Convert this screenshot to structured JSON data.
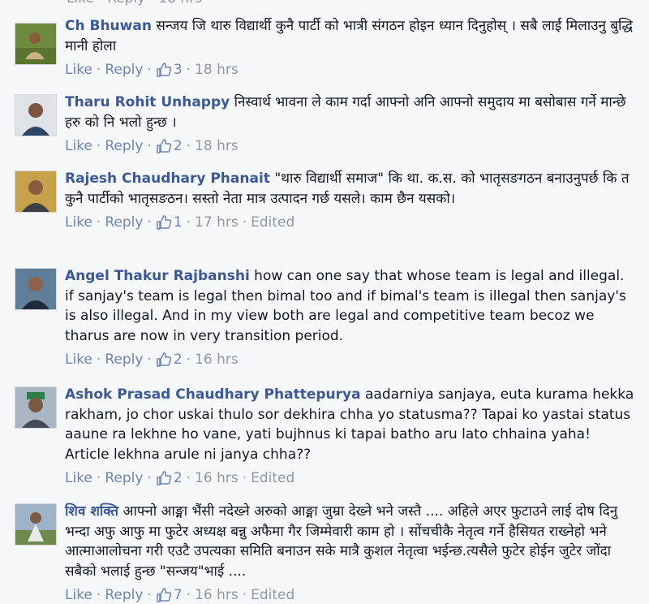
{
  "top_cut_text": "Like · Reply · 18 hrs",
  "labels": {
    "like": "Like",
    "reply": "Reply",
    "dot": "·"
  },
  "colors": {
    "author": "#3b5998",
    "link": "#6d84b4",
    "meta": "#9197a3",
    "text": "#141823",
    "background": "#f6f7f9"
  },
  "comments": [
    {
      "author": "Ch Bhuwan",
      "text": "सन्जय जि थारु विद्यार्थी कुनै पार्टी को भात्री संगठन होइन ध्यान दिनुहोस् । सबै लाई मिलाउनु बुद्धि मानी होला",
      "likes": "3",
      "time": "18 hrs",
      "edited": "",
      "avatar_icon": "person-outdoor-avatar-icon"
    },
    {
      "author": "Tharu Rohit Unhappy",
      "text": "निस्वार्थ भावना ले काम गर्दा आफ्नो अनि आफ्नो समुदाय मा बसोबास गर्ने मान्छे हरु को नि भलो हुन्छ ।",
      "likes": "2",
      "time": "18 hrs",
      "edited": "",
      "avatar_icon": "person-portrait-avatar-icon"
    },
    {
      "author": "Rajesh Chaudhary Phanait",
      "text": "\"थारु विद्यार्थी समाज\" कि था. क.स. को भातृसङगठन बनाउनुपर्छ कि त कुनै पार्टीको भातृसङठन। सस्तो नेता मात्र उत्पादन गर्छ यसले। काम छैन यसको।",
      "likes": "1",
      "time": "17 hrs",
      "edited": "Edited",
      "avatar_icon": "person-portrait-avatar-icon"
    },
    {
      "author": "Angel Thakur Rajbanshi",
      "text": "how can one say that whose team is legal and illegal. if sanjay's team is legal then bimal too and if bimal's team is illegal then sanjay's is also illegal. And in my view both are legal and competitive team becoz we tharus are now in very transition period.",
      "likes": "2",
      "time": "16 hrs",
      "edited": "",
      "avatar_icon": "person-portrait-avatar-icon"
    },
    {
      "author": "Ashok Prasad Chaudhary Phattepurya",
      "text": "aadarniya sanjaya, euta kurama hekka rakham, jo chor uskai thulo sor dekhira chha yo statusma?? Tapai ko yastai status aaune ra lekhne ho vane, yati bujhnus ki tapai batho aru lato chhaina yaha! Article lekhna arule ni janya chha??",
      "likes": "2",
      "time": "16 hrs",
      "edited": "Edited",
      "avatar_icon": "person-cap-avatar-icon"
    },
    {
      "author": "शिव शक्ति",
      "text": "आफ्नो आङ्मा भैंसी नदेख्ने अरुको आङ्मा जुम्रा देख्ने भने जस्तै .... अहिले अएर फुटाउने लाई दोष दिनु भन्दा अफु आफु मा फुटेर अध्यक्ष बन्नु अफैमा गैर जिम्मेवारी काम हो । सोंचचीकै नेतृत्व गर्ने हैसियत राख्नेहो भने आत्माआलोचना गरी एउटै उपत्यका समिति बनाउन सके मात्रै कुशल नेतृत्वा भईन्छ.त्यसैले फुटेर होईन जुटेर जोंदा सबैको भलाई हुन्छ \"सन्जय\"भाई ....",
      "likes": "7",
      "time": "16 hrs",
      "edited": "Edited",
      "avatar_icon": "person-outdoor-avatar-icon"
    }
  ]
}
